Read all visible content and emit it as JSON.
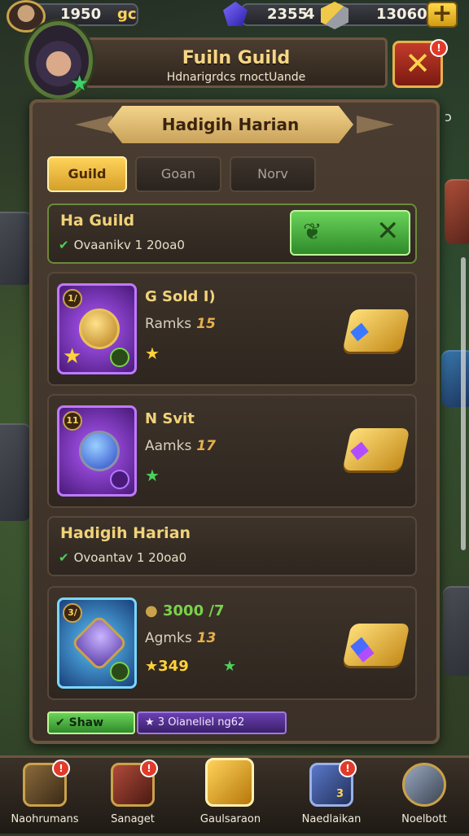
{
  "topbar": {
    "currency_left": "1950",
    "currency_left_tag": "gc",
    "gems": "2355",
    "gems_suffix": "4",
    "boxes": "13060",
    "plus_icon": "plus-icon"
  },
  "header": {
    "title": "Fuiln Guild",
    "subtitle": "Hdnarigrdcs rnoctUande",
    "close_badge": "!"
  },
  "panel": {
    "ribbon_title": "Hadigih Harian",
    "tabs": [
      {
        "label": "Guild",
        "active": true
      },
      {
        "label": "Goan",
        "active": false
      },
      {
        "label": "Norv",
        "active": false
      }
    ],
    "guild_card": {
      "title": "Ha Guild",
      "detail": "Ovaanikv 1 20oa0"
    },
    "items": [
      {
        "level": "1/",
        "name": "G Sold",
        "name_suffix": "I)",
        "rank_label": "Ramks",
        "rank_value": "15"
      },
      {
        "level": "11",
        "name": "N Svit",
        "rank_label": "Aamks",
        "rank_value": "17"
      },
      {
        "level": "3/",
        "name": "3000",
        "name_suffix": "/7",
        "rank_label": "Agmks",
        "rank_value": "13",
        "extra": "349"
      }
    ],
    "section_card": {
      "title": "Hadigih Harian",
      "detail": "Ovoantav 1 20oa0"
    },
    "footer": {
      "show_label": "Shaw",
      "info_text": "3  Oianeliel ng62"
    }
  },
  "bottom_nav": [
    {
      "label": "Naohrumans",
      "icon": "horn-icon",
      "badge": "!"
    },
    {
      "label": "Sanaget",
      "icon": "scroll-icon",
      "badge": "!"
    },
    {
      "label": "Gaulsaraon",
      "icon": "shield-icon",
      "badge": ""
    },
    {
      "label": "Naedlaikan",
      "icon": "rune-icon",
      "badge": "!",
      "count": "3"
    },
    {
      "label": "Noelbott",
      "icon": "crossed-swords-icon",
      "badge": ""
    }
  ],
  "colors": {
    "accent_gold": "#ffd25a",
    "accent_green": "#4cd15a",
    "badge_red": "#e23a2a",
    "panel_brown": "#3b3027"
  }
}
